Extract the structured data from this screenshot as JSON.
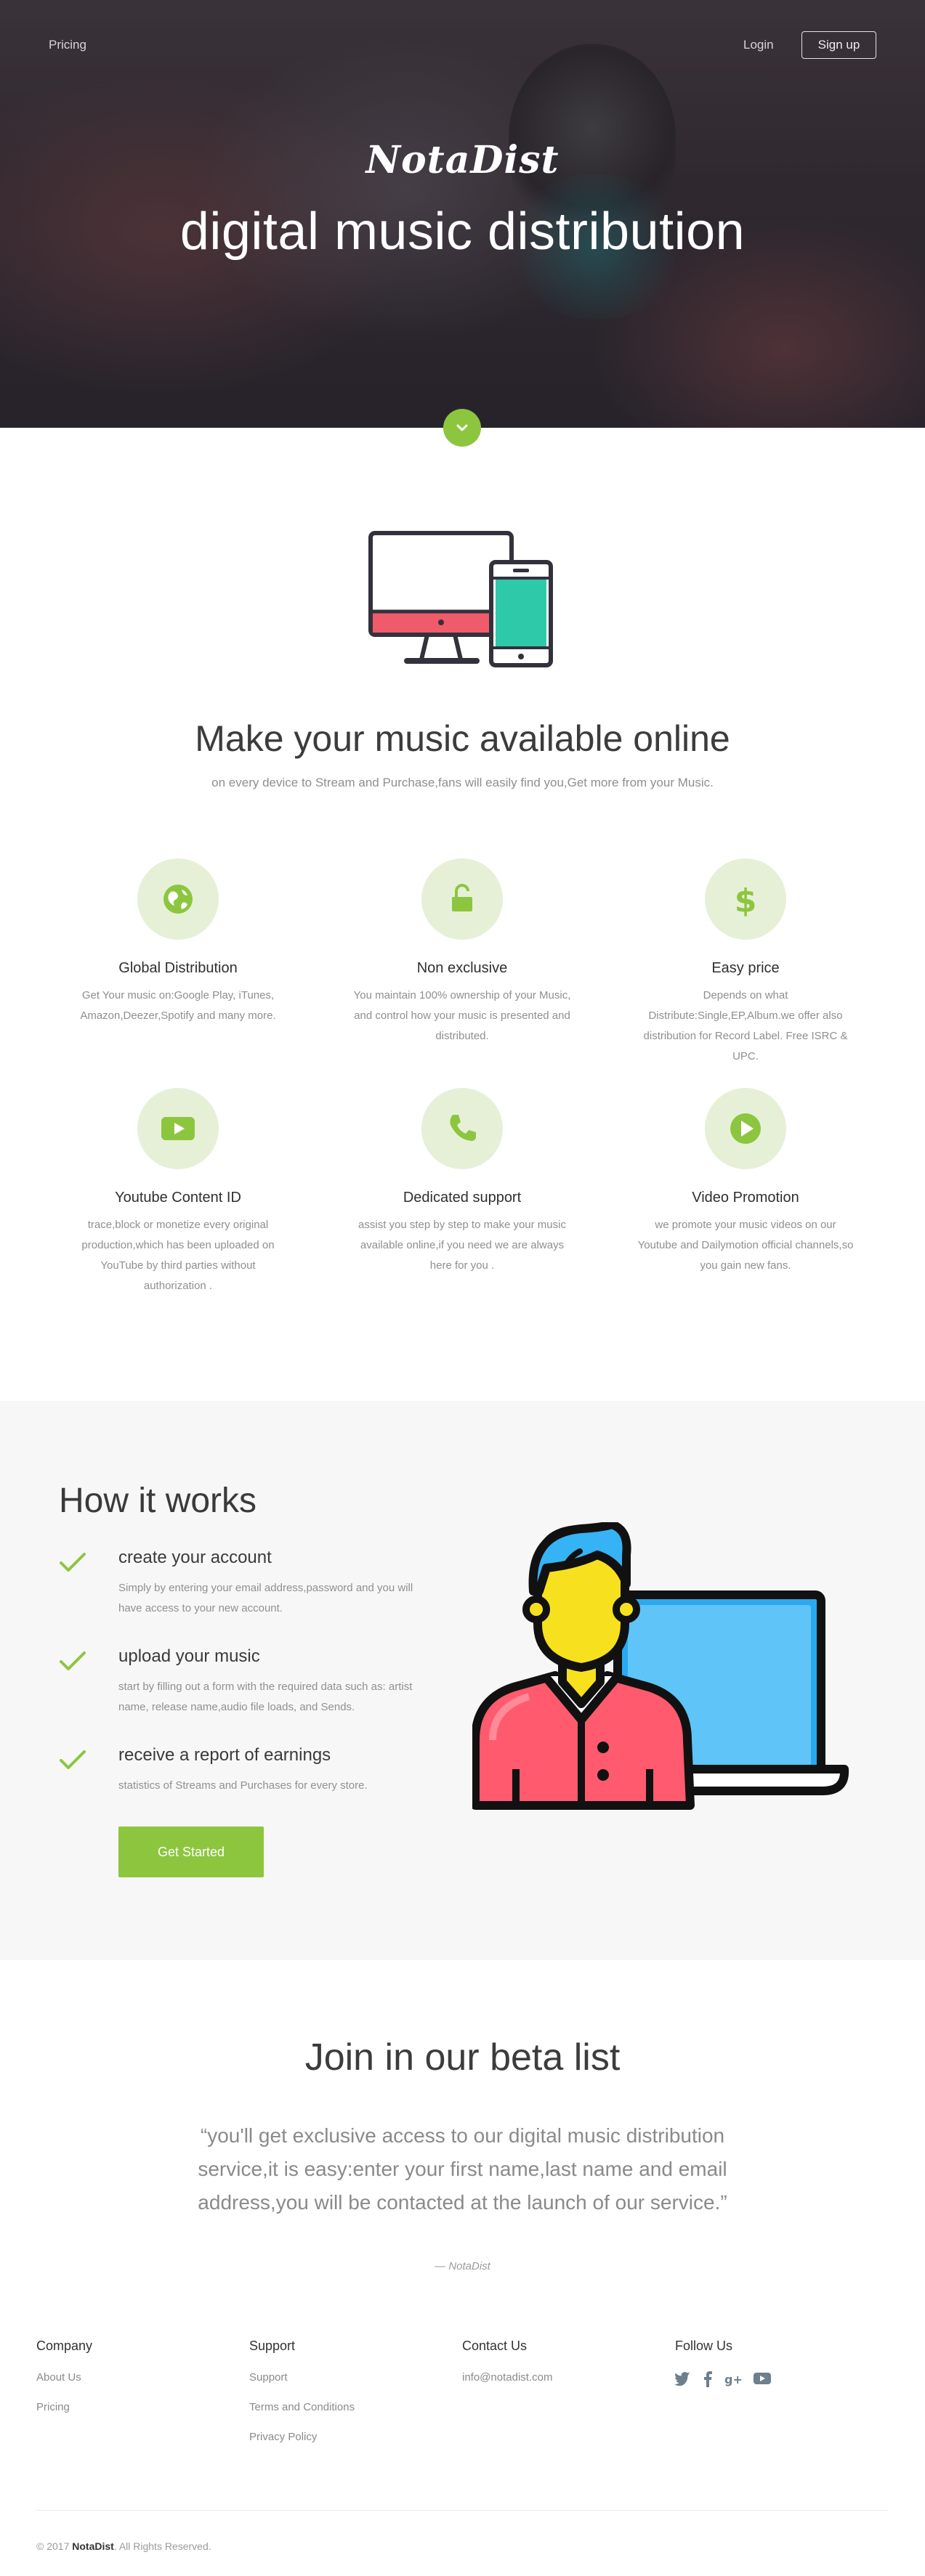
{
  "nav": {
    "pricing": "Pricing",
    "login": "Login",
    "signup": "Sign up"
  },
  "hero": {
    "brand": "NotaDist",
    "title": "digital music distribution",
    "scroll_icon": "chevron-down-icon"
  },
  "features_section": {
    "illustration": "devices-illustration",
    "title": "Make your music available online",
    "subtitle": "on every device to Stream and Purchase,fans will easily find you,Get more from your Music.",
    "items": [
      {
        "icon": "globe-icon",
        "title": "Global Distribution",
        "text": "Get Your music on:Google Play, iTunes, Amazon,Deezer,Spotify and many more."
      },
      {
        "icon": "unlock-icon",
        "title": "Non exclusive",
        "text": "You maintain 100% ownership of your Music, and control how your music is presented and distributed."
      },
      {
        "icon": "dollar-icon",
        "title": "Easy price",
        "text": "Depends on what Distribute:Single,EP,Album.we offer also distribution for Record Label. Free ISRC & UPC."
      },
      {
        "icon": "youtube-icon",
        "title": "Youtube Content ID",
        "text": "trace,block or monetize every original production,which has been uploaded on YouTube by third parties without authorization ."
      },
      {
        "icon": "phone-icon",
        "title": "Dedicated support",
        "text": "assist you step by step to make your music available online,if you need we are always here for you ."
      },
      {
        "icon": "play-circle-icon",
        "title": "Video Promotion",
        "text": "we promote your music videos on our Youtube and Dailymotion official channels,so you gain new fans."
      }
    ]
  },
  "how": {
    "title": "How it works",
    "steps": [
      {
        "icon": "check-icon",
        "title": "create your account",
        "text": "Simply by entering your email address,password and you will have access to your new account."
      },
      {
        "icon": "check-icon",
        "title": "upload your music",
        "text": "start by filling out a form with the required data such as: artist name, release name,audio file loads, and Sends."
      },
      {
        "icon": "check-icon",
        "title": "receive a report of earnings",
        "text": "statistics of Streams and Purchases for every store."
      }
    ],
    "cta": "Get Started",
    "illustration": "person-laptop-illustration"
  },
  "beta": {
    "title": "Join in our beta list",
    "quote": "“you'll get exclusive access to our digital music distribution service,it is easy:enter your first name,last name and email address,you will be contacted at the launch of our service.”",
    "author": "— NotaDist"
  },
  "footer": {
    "company": {
      "title": "Company",
      "links": [
        "About Us",
        "Pricing"
      ]
    },
    "support": {
      "title": "Support",
      "links": [
        "Support",
        "Terms and Conditions",
        "Privacy Policy"
      ]
    },
    "contact": {
      "title": "Contact Us",
      "email": "info@notadist.com"
    },
    "follow": {
      "title": "Follow Us",
      "icons": [
        "twitter-icon",
        "facebook-icon",
        "google-plus-icon",
        "youtube-icon"
      ]
    },
    "copyright_prefix": "© 2017",
    "copyright_brand": "NotaDist",
    "copyright_suffix": ". All Rights Reserved."
  },
  "colors": {
    "accent": "#8cc63f",
    "icon_bg": "#e6f0d7",
    "section_bg": "#f7f7f7"
  }
}
